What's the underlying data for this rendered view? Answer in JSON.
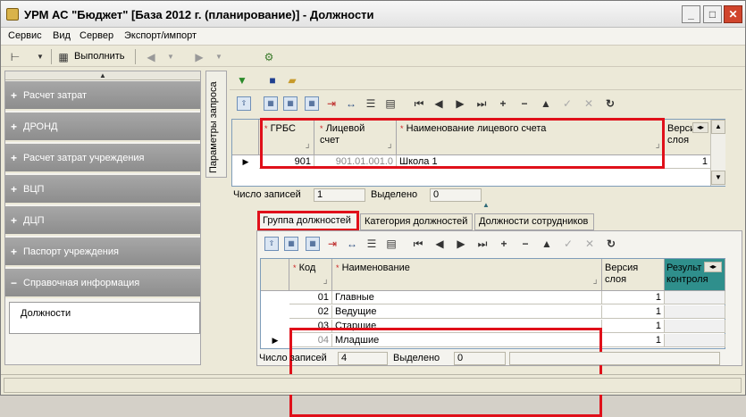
{
  "window": {
    "title": "УРМ АС \"Бюджет\" [База 2012 г. (планирование)] - Должности",
    "buttons": {
      "minimize": "_",
      "maximize": "□",
      "close": "✕"
    }
  },
  "menu": [
    "Сервис",
    "Вид",
    "Сервер",
    "Экспорт/импорт"
  ],
  "toolbar": {
    "execute_label": "Выполнить"
  },
  "left_panel": {
    "items": [
      {
        "label": "Расчет затрат",
        "sign": "+"
      },
      {
        "label": "ДРОНД",
        "sign": "+"
      },
      {
        "label": "Расчет затрат учреждения",
        "sign": "+"
      },
      {
        "label": "ВЦП",
        "sign": "+"
      },
      {
        "label": "ДЦП",
        "sign": "+"
      },
      {
        "label": "Паспорт учреждения",
        "sign": "+"
      },
      {
        "label": "Справочная информация",
        "sign": "−"
      }
    ],
    "selected_sub": "Должности"
  },
  "side_tab": {
    "label": "Параметры запроса"
  },
  "grid_top": {
    "columns": [
      {
        "label": "ГРБС",
        "star": true
      },
      {
        "label": "Лицевой счет",
        "star": true
      },
      {
        "label": "Наименование лицевого счета",
        "star": true
      },
      {
        "label": "Версия слоя",
        "star": false
      }
    ],
    "rows": [
      {
        "grbs": "901",
        "account": "901.01.001.0",
        "name": "Школа 1",
        "version": "1"
      }
    ],
    "status": {
      "records_label": "Число записей",
      "records": "1",
      "selected_label": "Выделено",
      "selected": "0"
    }
  },
  "tabs": [
    "Группа должностей",
    "Категория должностей",
    "Должности сотрудников"
  ],
  "grid_bottom": {
    "columns": [
      {
        "label": "Код",
        "star": true
      },
      {
        "label": "Наименование",
        "star": true
      },
      {
        "label": "Версия слоя",
        "star": false
      },
      {
        "label": "Результ контроля",
        "star": false
      }
    ],
    "rows": [
      {
        "code": "01",
        "name": "Главные",
        "version": "1"
      },
      {
        "code": "02",
        "name": "Ведущие",
        "version": "1"
      },
      {
        "code": "03",
        "name": "Старшие",
        "version": "1"
      },
      {
        "code": "04",
        "name": "Младшие",
        "version": "1"
      }
    ],
    "status": {
      "records_label": "Число записей",
      "records": "4",
      "selected_label": "Выделено",
      "selected": "0"
    }
  },
  "colors": {
    "highlight": "#e0101a",
    "nav_bg": "#9a9a9a",
    "teal_header": "#2f8f8c"
  }
}
